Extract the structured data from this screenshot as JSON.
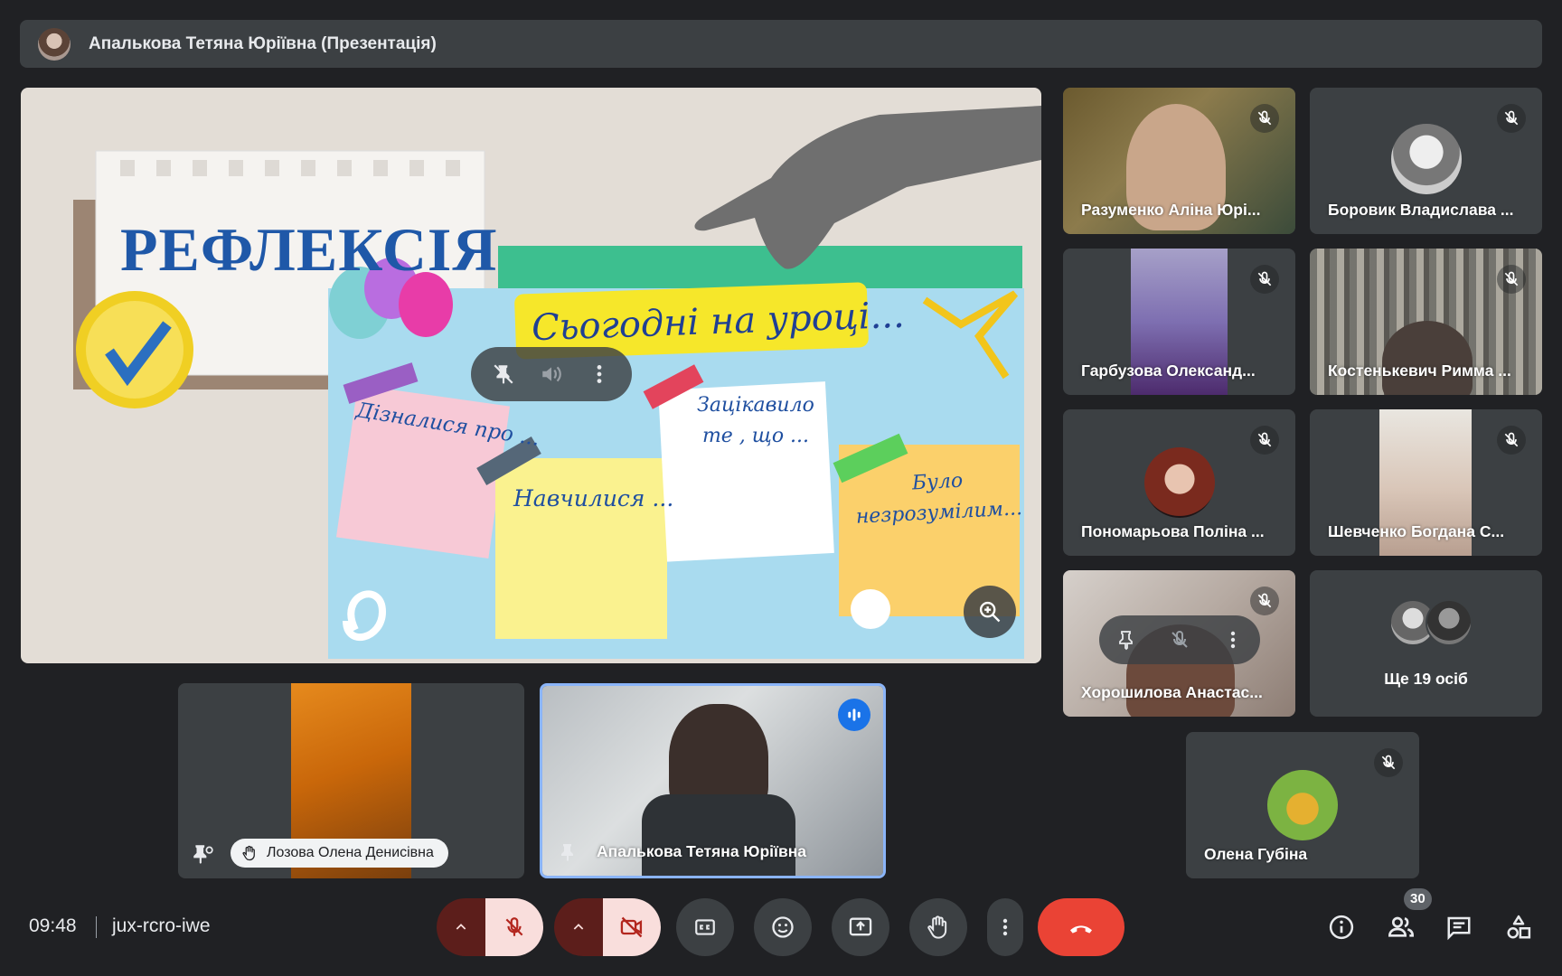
{
  "presenter_bar": {
    "title": "Апалькова Тетяна Юріївна (Презентація)"
  },
  "slide": {
    "heading": "РЕФЛЕКСІЯ",
    "board_title": "Сьогодні на уроці...",
    "notes": [
      "Дізналися про ...",
      "Навчилися ...",
      "Зацікавило\nте , що ...",
      "Було\nнезрозумілим..."
    ]
  },
  "participants": [
    {
      "name": "Разуменко Аліна Юрі..."
    },
    {
      "name": "Боровик Владислава ..."
    },
    {
      "name": "Гарбузова Олександ..."
    },
    {
      "name": "Костенькевич Римма ..."
    },
    {
      "name": "Пономарьова Поліна ..."
    },
    {
      "name": "Шевченко Богдана С..."
    },
    {
      "name": "Хорошилова Анастас..."
    }
  ],
  "more_participants": {
    "label": "Ще 19 осіб"
  },
  "single_tile": {
    "name": "Олена Губіна"
  },
  "bottom_tiles": {
    "hand_raised_name": "Лозова Олена Денисівна",
    "speaker_name": "Апалькова Тетяна Юріївна"
  },
  "controls": {
    "time": "09:48",
    "meeting_code": "jux-rcro-iwe",
    "people_count": "30"
  },
  "colors": {
    "background": "#202124",
    "tile": "#3c4043",
    "end_call": "#ea4335",
    "alert_bg": "#f9dedc",
    "alert_icon": "#b3261e",
    "speaking": "#8ab4f8"
  }
}
